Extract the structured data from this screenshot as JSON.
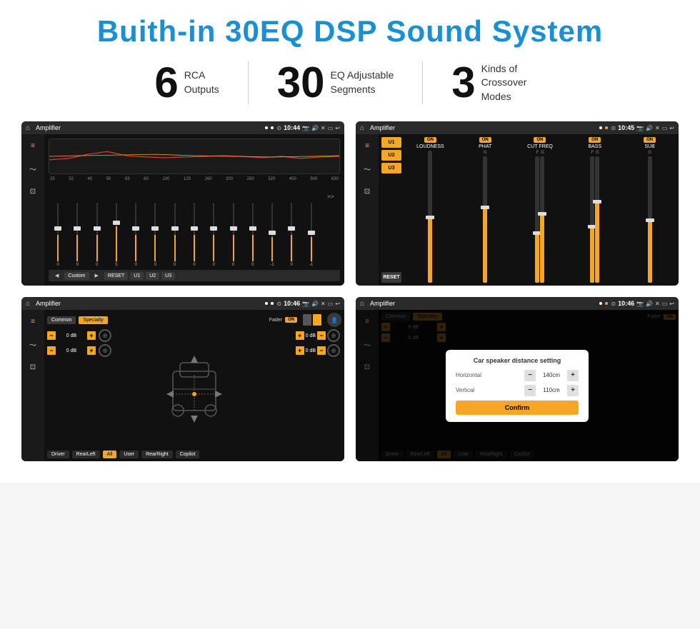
{
  "header": {
    "title": "Buith-in 30EQ DSP Sound System"
  },
  "stats": [
    {
      "number": "6",
      "label": "RCA\nOutputs"
    },
    {
      "number": "30",
      "label": "EQ Adjustable\nSegments"
    },
    {
      "number": "3",
      "label": "Kinds of\nCrossover Modes"
    }
  ],
  "screens": [
    {
      "id": "eq-screen",
      "statusBar": {
        "appName": "Amplifier",
        "time": "10:44",
        "dots": [
          "white",
          "white"
        ]
      },
      "type": "eq"
    },
    {
      "id": "crossover-screen",
      "statusBar": {
        "appName": "Amplifier",
        "time": "10:45",
        "dots": [
          "white",
          "orange"
        ]
      },
      "type": "crossover"
    },
    {
      "id": "fader-screen",
      "statusBar": {
        "appName": "Amplifier",
        "time": "10:46",
        "dots": [
          "white",
          "white"
        ]
      },
      "type": "fader"
    },
    {
      "id": "dialog-screen",
      "statusBar": {
        "appName": "Amplifier",
        "time": "10:46",
        "dots": [
          "white",
          "orange"
        ]
      },
      "type": "dialog"
    }
  ],
  "eq": {
    "frequencies": [
      "25",
      "32",
      "40",
      "50",
      "63",
      "80",
      "100",
      "125",
      "160",
      "200",
      "250",
      "320",
      "400",
      "500",
      "630"
    ],
    "values": [
      "0",
      "0",
      "0",
      "5",
      "0",
      "0",
      "0",
      "0",
      "0",
      "0",
      "0",
      "-1",
      "0",
      "-1"
    ],
    "buttons": [
      "Custom",
      "RESET",
      "U1",
      "U2",
      "U3"
    ]
  },
  "crossover": {
    "channels": [
      "U1",
      "U2",
      "U3"
    ],
    "controls": [
      "LOUDNESS",
      "PHAT",
      "CUT FREQ",
      "BASS",
      "SUB"
    ],
    "resetLabel": "RESET"
  },
  "fader": {
    "tabs": [
      "Common",
      "Specialty"
    ],
    "activeTab": "Specialty",
    "faderLabel": "Fader",
    "dbValues": [
      "0 dB",
      "0 dB",
      "0 dB",
      "0 dB"
    ],
    "zones": [
      "Driver",
      "RearLeft",
      "All",
      "User",
      "RearRight",
      "Copilot"
    ]
  },
  "dialog": {
    "title": "Car speaker distance setting",
    "horizontal": {
      "label": "Horizontal",
      "value": "140cm"
    },
    "vertical": {
      "label": "Vertical",
      "value": "110cm"
    },
    "confirmLabel": "Confirm"
  }
}
